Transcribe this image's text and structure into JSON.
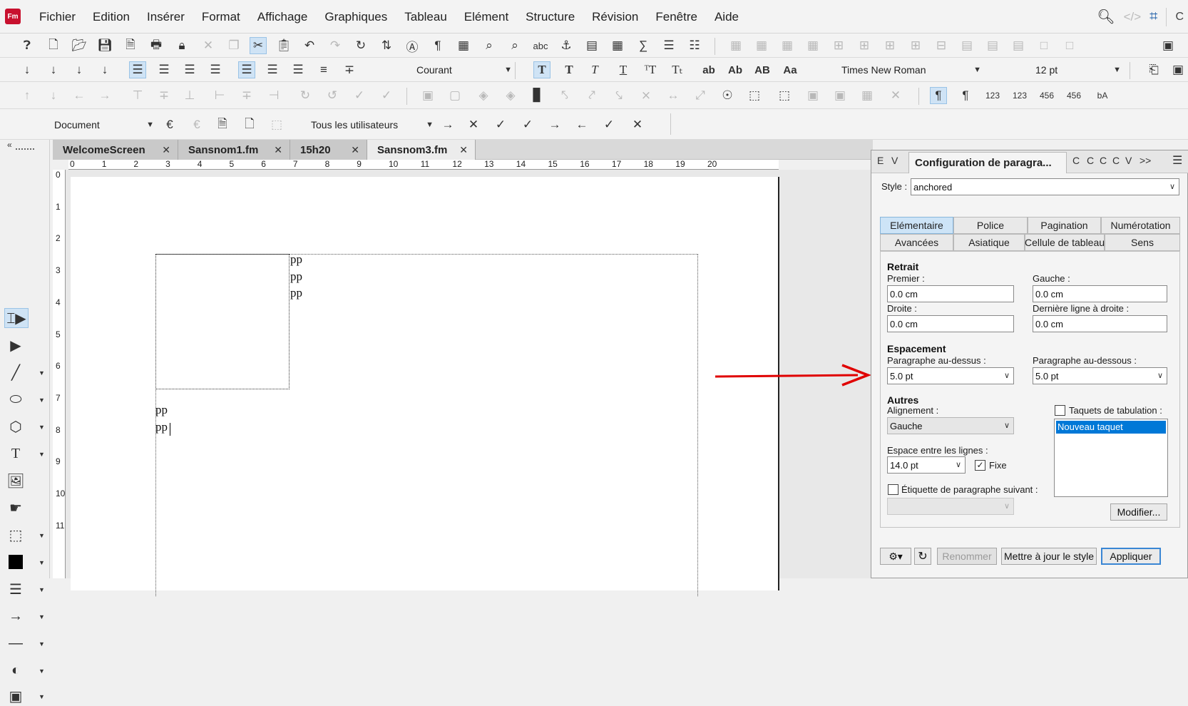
{
  "app": {
    "logo": "Fm"
  },
  "menu": [
    "Fichier",
    "Edition",
    "Insérer",
    "Format",
    "Affichage",
    "Graphiques",
    "Tableau",
    "Elément",
    "Structure",
    "Révision",
    "Fenêtre",
    "Aide"
  ],
  "menu_right": {
    "cut_label": "C"
  },
  "toolbar_format": {
    "paragraph_tag": "Courant",
    "font_family": "Times New Roman",
    "font_size": "12 pt"
  },
  "toolbar_track": {
    "view": "Document",
    "users": "Tous les utilisateurs"
  },
  "tabs": [
    {
      "label": "WelcomeScreen",
      "active": false
    },
    {
      "label": "Sansnom1.fm",
      "active": false
    },
    {
      "label": "15h20",
      "active": false
    },
    {
      "label": "Sansnom3.fm",
      "active": true
    }
  ],
  "ruler_h": [
    "0",
    "1",
    "2",
    "3",
    "4",
    "5",
    "6",
    "7",
    "8",
    "9",
    "10",
    "11",
    "12",
    "13",
    "14",
    "15",
    "16",
    "17",
    "18",
    "19",
    "20"
  ],
  "ruler_v": [
    "0",
    "1",
    "2",
    "3",
    "4",
    "5",
    "6",
    "7",
    "8",
    "9",
    "10",
    "11"
  ],
  "document": {
    "lines_right": [
      "pp",
      "pp",
      "pp"
    ],
    "lines_below": [
      "pp",
      "pp"
    ]
  },
  "panel": {
    "mini_tabs": [
      "E",
      "V",
      "C",
      "C",
      "C",
      "C",
      "V"
    ],
    "title": "Configuration de paragra...",
    "overflow": ">>",
    "style_label": "Style :",
    "style_value": "anchored",
    "tabs_row1": [
      "Elémentaire",
      "Police",
      "Pagination",
      "Numérotation"
    ],
    "tabs_row2": [
      "Avancées",
      "Asiatique",
      "Cellule de tableau",
      "Sens"
    ],
    "active_tab": "Elémentaire",
    "retrait": {
      "title": "Retrait",
      "premier_label": "Premier :",
      "premier_value": "0.0 cm",
      "gauche_label": "Gauche :",
      "gauche_value": "0.0 cm",
      "droite_label": "Droite :",
      "droite_value": "0.0 cm",
      "derniere_label": "Dernière ligne à droite :",
      "derniere_value": "0.0 cm"
    },
    "espacement": {
      "title": "Espacement",
      "dessus_label": "Paragraphe au-dessus :",
      "dessus_value": "5.0 pt",
      "dessous_label": "Paragraphe au-dessous :",
      "dessous_value": "5.0 pt"
    },
    "autres": {
      "title": "Autres",
      "alignement_label": "Alignement :",
      "alignement_value": "Gauche",
      "interligne_label": "Espace entre les lignes :",
      "interligne_value": "14.0 pt",
      "fixe_label": "Fixe",
      "fixe_checked": true,
      "etiquette_label": "Étiquette de paragraphe suivant :",
      "etiquette_checked": false,
      "taquets_label": "Taquets de tabulation :",
      "taquets_checked": false,
      "taquets_items": [
        "Nouveau taquet"
      ],
      "modifier_label": "Modifier..."
    },
    "footer": {
      "rename": "Renommer",
      "update": "Mettre à jour le style",
      "apply": "Appliquer"
    }
  },
  "colors": {
    "accent": "#3a86d4",
    "arrow": "#e00000",
    "selection": "#0078d7"
  }
}
